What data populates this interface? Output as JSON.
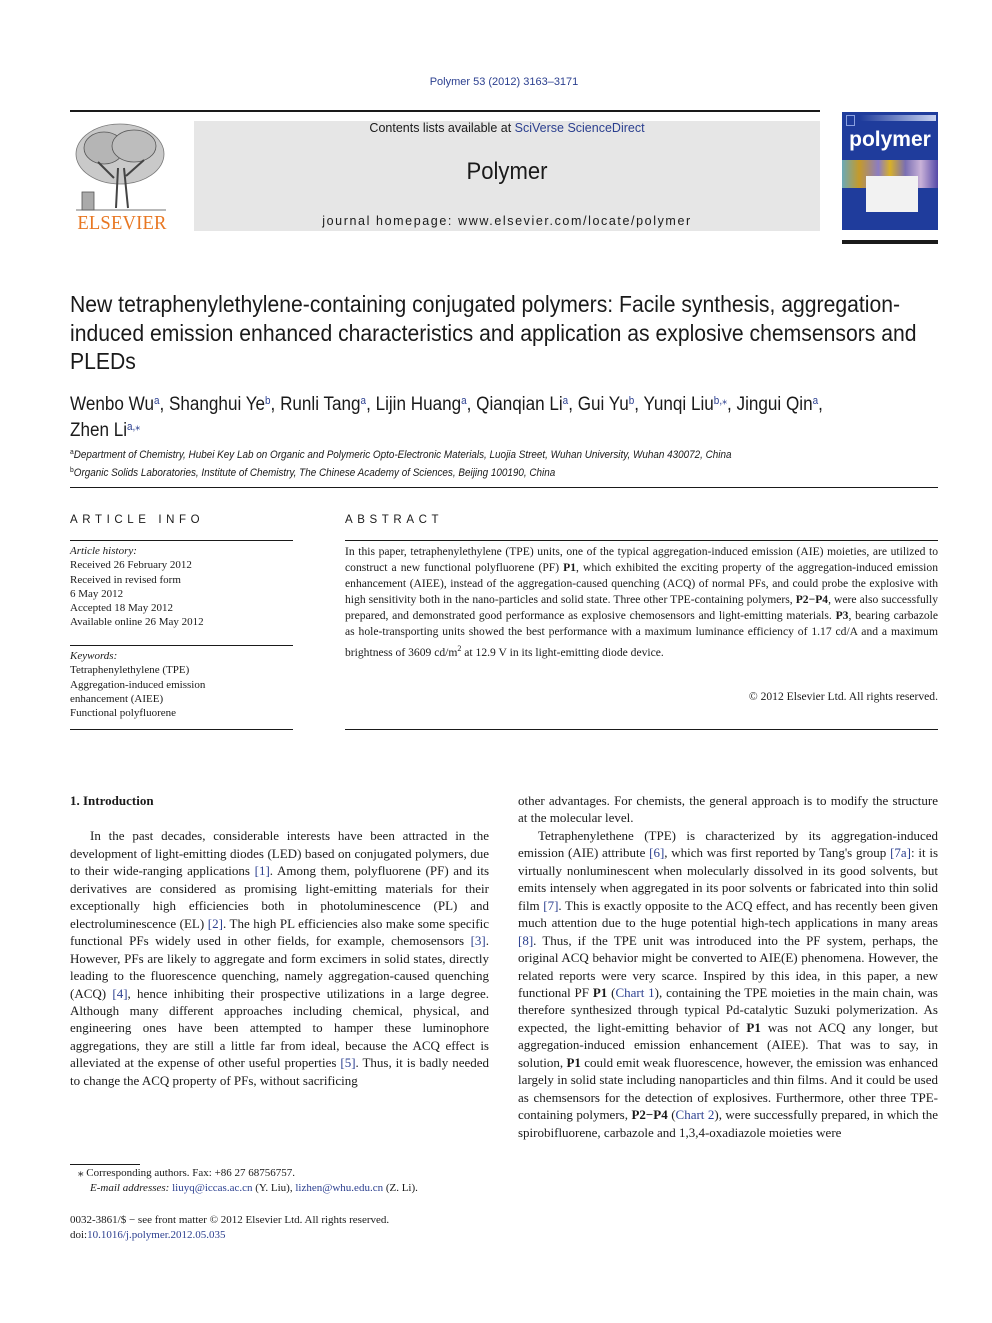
{
  "header": {
    "journal_reference": "Polymer 53 (2012) 3163–3171",
    "contents_prefix": "Contents lists available at ",
    "contents_link": "SciVerse ScienceDirect",
    "journal_name": "Polymer",
    "homepage_prefix": "journal homepage: ",
    "homepage_url": "www.elsevier.com/locate/polymer",
    "publisher_logo_text": "ELSEVIER",
    "cover_title": "polymer",
    "colors": {
      "link": "#2b3f8f",
      "elsevier_orange": "#e87722",
      "cover_blue": "#1f3c9c",
      "header_box": "#e6e6e6"
    }
  },
  "article": {
    "title": "New tetraphenylethylene-containing conjugated polymers: Facile synthesis, aggregation-induced emission enhanced characteristics and application as explosive chemsensors and PLEDs",
    "authors": [
      {
        "name": "Wenbo Wu",
        "aff": "a"
      },
      {
        "name": "Shanghui Ye",
        "aff": "b"
      },
      {
        "name": "Runli Tang",
        "aff": "a"
      },
      {
        "name": "Lijin Huang",
        "aff": "a"
      },
      {
        "name": "Qianqian Li",
        "aff": "a"
      },
      {
        "name": "Gui Yu",
        "aff": "b"
      },
      {
        "name": "Yunqi Liu",
        "aff": "b,⁎"
      },
      {
        "name": "Jingui Qin",
        "aff": "a"
      },
      {
        "name": "Zhen Li",
        "aff": "a,⁎"
      }
    ],
    "affiliations": [
      {
        "mark": "a",
        "text": "Department of Chemistry, Hubei Key Lab on Organic and Polymeric Opto-Electronic Materials, Luojia Street, Wuhan University, Wuhan 430072, China"
      },
      {
        "mark": "b",
        "text": "Organic Solids Laboratories, Institute of Chemistry, The Chinese Academy of Sciences, Beijing 100190, China"
      }
    ]
  },
  "article_info": {
    "heading": "ARTICLE INFO",
    "history_label": "Article history:",
    "history": [
      "Received 26 February 2012",
      "Received in revised form",
      "6 May 2012",
      "Accepted 18 May 2012",
      "Available online 26 May 2012"
    ],
    "keywords_label": "Keywords:",
    "keywords": [
      "Tetraphenylethylene (TPE)",
      "Aggregation-induced emission",
      "enhancement (AIEE)",
      "Functional polyfluorene"
    ]
  },
  "abstract": {
    "heading": "ABSTRACT",
    "p1": "In this paper, tetraphenylethylene (TPE) units, one of the typical aggregation-induced emission (AIE) moieties, are utilized to construct a new functional polyfluorene (PF) ",
    "b1": "P1",
    "p2": ", which exhibited the exciting property of the aggregation-induced emission enhancement (AIEE), instead of the aggregation-caused quenching (ACQ) of normal PFs, and could probe the explosive with high sensitivity both in the nano-particles and solid state. Three other TPE-containing polymers, ",
    "b2": "P2−P4",
    "p3": ", were also successfully prepared, and demonstrated good performance as explosive chemosensors and light-emitting materials. ",
    "b3": "P3",
    "p4": ", bearing carbazole as hole-transporting units showed the best performance with a maximum luminance efficiency of 1.17 cd/A and a maximum brightness of 3609 cd/m",
    "sup": "2",
    "p5": " at 12.9 V in its light-emitting diode device.",
    "copyright": "© 2012 Elsevier Ltd. All rights reserved."
  },
  "body": {
    "section_title": "1.  Introduction",
    "left": {
      "t1": "In the past decades, considerable interests have been attracted in the development of light-emitting diodes (LED) based on conjugated polymers, due to their wide-ranging applications ",
      "r1": "[1]",
      "t2": ". Among them, polyfluorene (PF) and its derivatives are considered as promising light-emitting materials for their exceptionally high efficiencies both in photoluminescence (PL) and electroluminescence (EL) ",
      "r2": "[2]",
      "t3": ". The high PL efficiencies also make some specific functional PFs widely used in other fields, for example, chemosensors ",
      "r3": "[3]",
      "t4": ". However, PFs are likely to aggregate and form excimers in solid states, directly leading to the fluorescence quenching, namely aggregation-caused quenching (ACQ) ",
      "r4": "[4]",
      "t5": ", hence inhibiting their prospective utilizations in a large degree. Although many different approaches including chemical, physical, and engineering ones have been attempted to hamper these luminophore aggregations, they are still a little far from ideal, because the ACQ effect is alleviated at the expense of other useful properties ",
      "r5": "[5]",
      "t6": ". Thus, it is badly needed to change the ACQ property of PFs, without sacrificing"
    },
    "right": {
      "t0": "other advantages. For chemists, the general approach is to modify the structure at the molecular level.",
      "t1": "Tetraphenylethene (TPE) is characterized by its aggregation-induced emission (AIE) attribute ",
      "r6": "[6]",
      "t2": ", which was first reported by Tang's group ",
      "r7a": "[7a]",
      "t3": ": it is virtually nonluminescent when molecularly dissolved in its good solvents, but emits intensely when aggregated in its poor solvents or fabricated into thin solid film ",
      "r7": "[7]",
      "t4": ". This is exactly opposite to the ACQ effect, and has recently been given much attention due to the huge potential high-tech applications in many areas ",
      "r8": "[8]",
      "t5": ". Thus, if the TPE unit was introduced into the PF system, perhaps, the original ACQ behavior might be converted to AIE(E) phenomena. However, the related reports were very scarce. Inspired by this idea, in this paper, a new functional PF ",
      "b1": "P1",
      "t6": " (",
      "c1": "Chart 1",
      "t7": "), containing the TPE moieties in the main chain, was therefore synthesized through typical Pd-catalytic Suzuki polymerization. As expected, the light-emitting behavior of ",
      "b2": "P1",
      "t8": " was not ACQ any longer, but aggregation-induced emission enhancement (AIEE). That was to say, in solution, ",
      "b3": "P1",
      "t9": " could emit weak fluorescence, however, the emission was enhanced largely in solid state including nanoparticles and thin films. And it could be used as chemsensors for the detection of explosives. Furthermore, other three TPE-containing polymers, ",
      "b4": "P2−P4",
      "t10": " (",
      "c2": "Chart 2",
      "t11": "), were successfully prepared, in which the spirobifluorene, carbazole and 1,3,4-oxadiazole moieties were"
    }
  },
  "footnotes": {
    "star": "⁎",
    "corresponding": "Corresponding authors. Fax: +86 27 68756757.",
    "email_label": "E-mail addresses:",
    "email1": "liuyq@iccas.ac.cn",
    "email1_who": " (Y. Liu), ",
    "email2": "lizhen@whu.edu.cn",
    "email2_who": " (Z. Li).",
    "front_matter": "0032-3861/$ − see front matter © 2012 Elsevier Ltd. All rights reserved.",
    "doi_prefix": "doi:",
    "doi": "10.1016/j.polymer.2012.05.035"
  }
}
